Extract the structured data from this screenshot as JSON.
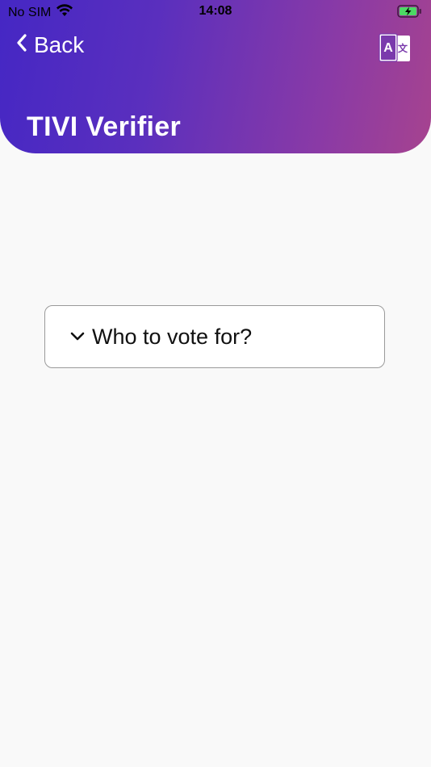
{
  "status_bar": {
    "carrier": "No SIM",
    "time": "14:08",
    "wifi_icon": "wifi-icon",
    "battery_icon": "battery-charging-icon"
  },
  "header": {
    "back_label": "Back",
    "title": "TIVI Verifier",
    "translate_icon": "translate-icon",
    "translate_glyph_a": "A",
    "translate_glyph_b": "文",
    "colors": {
      "gradient_start": "#4527c4",
      "gradient_end": "#a6438f",
      "text": "#ffffff"
    }
  },
  "main": {
    "accordion": {
      "label": "Who to vote for?",
      "expanded": false,
      "chevron_icon": "chevron-down-icon"
    }
  },
  "colors": {
    "background": "#f9f9f9"
  }
}
